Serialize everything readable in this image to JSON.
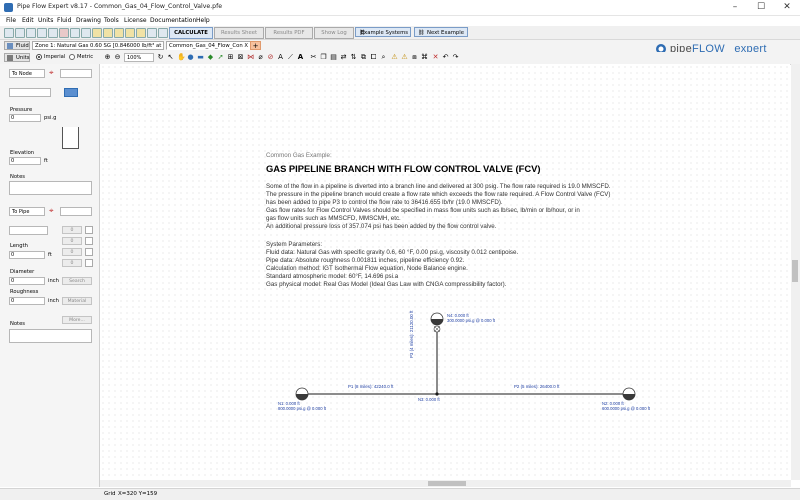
{
  "window": {
    "title": "Pipe Flow Expert v8.17 - Common_Gas_04_Flow_Control_Valve.pfe",
    "minimize": "–",
    "maximize": "☐",
    "close": "✕"
  },
  "menu": [
    "File",
    "Edit",
    "Units",
    "Fluid",
    "Drawing",
    "Tools",
    "License",
    "Documentation",
    "Help"
  ],
  "toolbar": {
    "calculate": "CALCULATE",
    "results_sheet": "Results Sheet",
    "results_pdf": "Results PDF",
    "show_log": "Show Log",
    "example_systems": "Example Systems",
    "next_example": "Next Example"
  },
  "tabs": {
    "fluid": "Fluid",
    "zone": "Zone 1: Natural Gas 0.60 SG [0.846000 lb/ft³ at 0 lb/i",
    "file": "Common_Gas_04_Flow_Con X",
    "units": "Units",
    "imperial": "Imperial",
    "metric": "Metric",
    "zoom": "100%"
  },
  "logo": {
    "brand1": "pipe",
    "brand2": "FLOW",
    "brand3": "expert",
    "url": "www.pipeflow.com"
  },
  "left_panel": {
    "to_node": "To Node",
    "pressure_label": "Pressure",
    "pressure_value": "0",
    "pressure_unit": "psi.g",
    "elevation_label": "Elevation",
    "elevation_value": "0",
    "elevation_unit": "ft",
    "notes_label": "Notes",
    "to_pipe": "To Pipe",
    "length_label": "Length",
    "length_value": "0",
    "length_unit": "ft",
    "diameter_label": "Diameter",
    "diameter_value": "0",
    "diameter_unit": "inch",
    "search": "Search",
    "roughness_label": "Roughness",
    "roughness_value": "0",
    "roughness_unit": "inch",
    "material": "Material",
    "more": "More...",
    "notes2_label": "Notes",
    "small_vals": [
      "0",
      "0",
      "0",
      "0"
    ]
  },
  "canvas": {
    "subtitle": "Common Gas Example:",
    "heading": "GAS PIPELINE BRANCH WITH FLOW CONTROL VALVE (FCV)",
    "para": [
      "Some of the flow in a pipeline is diverted into a branch line and delivered at 300 psig. The flow rate required is 19.0 MMSCFD.",
      "The pressure in the pipeline branch would create a flow rate which exceeds the flow rate required. A Flow Control Valve (FCV)",
      "has been added to pipe P3 to control the flow rate to 36416.655 lb/hr (19.0 MMSCFD).",
      "Gas flow rates for Flow Control Valves should be specified in mass flow units such as lb/sec, lb/min or lb/hour, or in",
      "gas flow units such as MMSCFD, MMSCMH, etc.",
      "An additional pressure loss of 357.074 psi has been added by the flow control valve."
    ],
    "params": [
      "System Parameters:",
      "Fluid data: Natural Gas with specific gravity 0.6, 60 °F, 0.00 psi.g, viscosity 0.012 centipoise.",
      "Pipe data: Absolute roughness 0.001811 inches, pipeline efficiency 0.92.",
      "Calculation method: IGT Isothermal Flow equation, Node Balance engine.",
      "Standard atmospheric model: 60°F, 14.696 psi.a",
      "Gas physical model: Real Gas Model (Ideal Gas Law with CNGA compressibility factor)."
    ],
    "n1": [
      "N1: 0.000 ft",
      "800.0000 psi.g @ 0.000 ft"
    ],
    "n2": [
      "N2: 0.000 ft",
      "600.0000 psi.g @ 0.000 ft"
    ],
    "n3": "N3: 0.000 ft",
    "n4": [
      "N4: 0.000 ft",
      "300.0000 psi.g @ 0.000 ft"
    ],
    "p1": "P1 (8 miles): 42240.0 ft",
    "p2": "P2 (5 miles): 26400.0 ft",
    "p3": "P3 (4 miles): 21120.00 ft"
  },
  "status": {
    "grid": "Grid",
    "coords": "X=320  Y=159"
  },
  "colors": {
    "pipe": "#1a1a1a",
    "label_blue": "#1f3fa3",
    "brand_blue": "#2f6db3"
  }
}
